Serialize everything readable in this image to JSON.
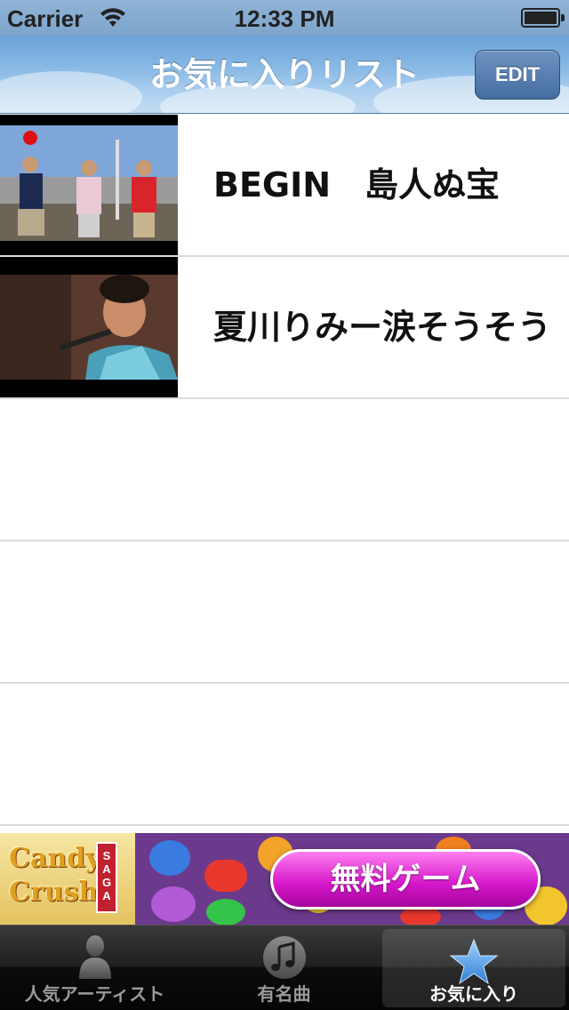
{
  "status_bar": {
    "carrier": "Carrier",
    "time": "12:33 PM"
  },
  "nav": {
    "title": "お気に入りリスト",
    "edit_label": "EDIT"
  },
  "favorites": [
    {
      "title": "BEGIN　島人ぬ宝"
    },
    {
      "title": "夏川りみー涙そうそう"
    }
  ],
  "ad": {
    "brand_lettering": "Candy Crush SAGA",
    "button_label": "無料ゲーム"
  },
  "tabs": [
    {
      "label": "人気アーティスト",
      "icon": "person-icon",
      "selected": false
    },
    {
      "label": "有名曲",
      "icon": "music-note-icon",
      "selected": false
    },
    {
      "label": "お気に入り",
      "icon": "star-icon",
      "selected": true
    }
  ],
  "colors": {
    "nav_sky": "#8cbbe6",
    "tab_selected_icon": "#5aa7e8",
    "ad_button": "#d316c9"
  }
}
